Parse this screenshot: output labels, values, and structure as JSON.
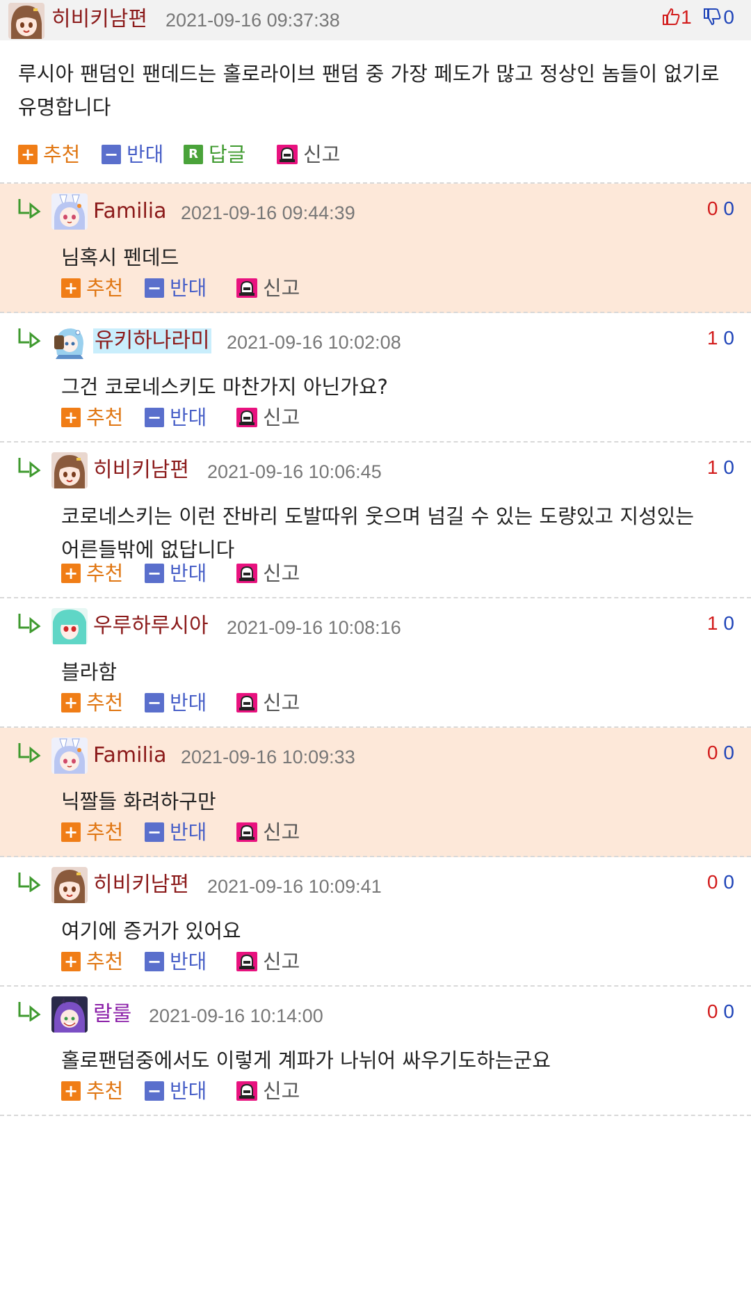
{
  "top_post": {
    "nickname": "히비키남편",
    "datetime": "2021-09-16 09:37:38",
    "up_count": "1",
    "down_count": "0",
    "text": "루시아 팬덤인 팬데드는 홀로라이브 팬덤 중 가장 페도가 많고 정상인 놈들이 없기로 유명합니다"
  },
  "actions": {
    "recommend": "추천",
    "oppose": "반대",
    "reply": "답글",
    "report": "신고",
    "reply_icon_letter": "R"
  },
  "comments": [
    {
      "nickname": "Familia",
      "datetime": "2021-09-16 09:44:39",
      "up": "0",
      "down": "0",
      "text": "님혹시 펜데드",
      "highlight": true,
      "avatar": "pekora-avatar"
    },
    {
      "nickname": "유키하나라미",
      "datetime": "2021-09-16 10:02:08",
      "up": "1",
      "down": "0",
      "text": "그건 코로네스키도 마찬가지 아닌가요?",
      "highlight": false,
      "avatar": "lamy-avatar"
    },
    {
      "nickname": "히비키남편",
      "datetime": "2021-09-16 10:06:45",
      "up": "1",
      "down": "0",
      "text": "코로네스키는 이런 잔바리 도발따위 웃으며 넘길 수 있는 도량있고 지성있는 어른들밖에 없답니다",
      "highlight": false,
      "avatar": "korone-avatar"
    },
    {
      "nickname": "우루하루시아",
      "datetime": "2021-09-16 10:08:16",
      "up": "1",
      "down": "0",
      "text": "블라함",
      "highlight": false,
      "avatar": "rushia-avatar"
    },
    {
      "nickname": "Familia",
      "datetime": "2021-09-16 10:09:33",
      "up": "0",
      "down": "0",
      "text": "닉짤들 화려하구만",
      "highlight": true,
      "avatar": "pekora-avatar"
    },
    {
      "nickname": "히비키남편",
      "datetime": "2021-09-16 10:09:41",
      "up": "0",
      "down": "0",
      "text": "여기에 증거가 있어요",
      "highlight": false,
      "avatar": "korone-avatar"
    },
    {
      "nickname": "랄룰",
      "datetime": "2021-09-16 10:14:00",
      "up": "0",
      "down": "0",
      "text": "홀로팬덤중에서도 이렇게 계파가 나뉘어 싸우기도하는군요",
      "highlight": false,
      "avatar": "towa-avatar"
    }
  ],
  "colors": {
    "nickname": "#8b1a1a",
    "nickname_purple": "#8b1fa8",
    "highlight_bg": "#fde8d9",
    "up": "#d21b1b",
    "down": "#1f44b8"
  }
}
